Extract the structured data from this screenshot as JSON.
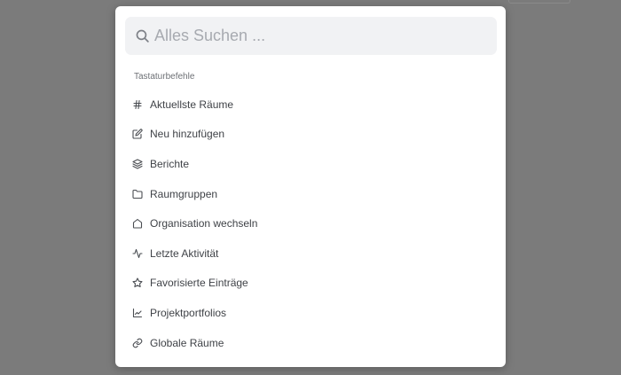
{
  "search": {
    "placeholder": "Alles Suchen ..."
  },
  "section_title": "Tastaturbefehle",
  "items": [
    {
      "icon": "hash-icon",
      "label": "Aktuellste Räume"
    },
    {
      "icon": "edit-icon",
      "label": "Neu hinzufügen"
    },
    {
      "icon": "layers-icon",
      "label": "Berichte"
    },
    {
      "icon": "folder-icon",
      "label": "Raumgruppen"
    },
    {
      "icon": "home-icon",
      "label": "Organisation wechseln"
    },
    {
      "icon": "activity-icon",
      "label": "Letzte Aktivität"
    },
    {
      "icon": "star-icon",
      "label": "Favorisierte Einträge"
    },
    {
      "icon": "chart-line-icon",
      "label": "Projektportfolios"
    },
    {
      "icon": "link-icon",
      "label": "Globale Räume"
    }
  ],
  "colors": {
    "overlay": "#7b7b7b",
    "modal": "#ffffff",
    "search_bg": "#f1f2f4",
    "text": "#3f4247"
  }
}
